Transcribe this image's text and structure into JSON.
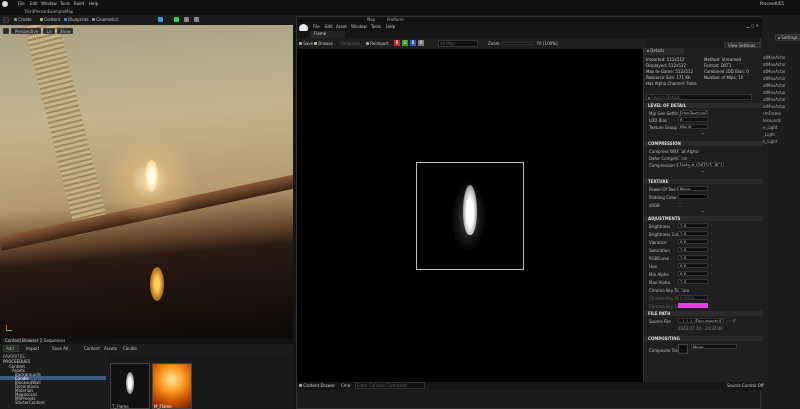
{
  "main_menu": [
    "File",
    "Edit",
    "Window",
    "Tools",
    "Build",
    "Help"
  ],
  "project_tab": "ThirdPersonExampleMap",
  "project_name": "ProceedUE5",
  "toolbar": [
    "Create",
    "Content",
    "Blueprints",
    "Cinematics"
  ],
  "settings_label": "Settings",
  "viewport": {
    "perspective": "Perspective",
    "lit": "Lit",
    "show": "Show"
  },
  "outliner": {
    "items": [
      "atMovActor",
      "atMovActor",
      "atMovActor",
      "atMovActor",
      "atMovActor",
      "atMovActor",
      "atMovActor",
      "atMovActor",
      "rmFrame",
      "lesounds",
      "e_Light",
      "_Light",
      "k_Light"
    ]
  },
  "content_browser": {
    "tabs": [
      "Content Browser 1",
      "Sequencer"
    ],
    "toolbar": [
      "Add",
      "Import",
      "Save All"
    ],
    "path": [
      "Content",
      "Assets",
      "Candle"
    ],
    "favorites_label": "FAVORITES",
    "project_label": "PROCEEDUE5",
    "tree": [
      "Content",
      "Assets",
      "Backgrounds",
      "Candle",
      "BlockoutWall",
      "Decorations",
      "Materials",
      "Megascans",
      "MSPresets",
      "StarterContent"
    ],
    "assets": [
      {
        "name": "T_Flame"
      },
      {
        "name": "M_Flame"
      }
    ]
  },
  "editor": {
    "tabs": [
      "Map",
      "Platform"
    ],
    "asset_tab": "Flame",
    "menu": [
      "File",
      "Edit",
      "Asset",
      "Window",
      "Tools",
      "Help"
    ],
    "toolbar": {
      "save": "Save",
      "browse": "Browse",
      "compress": "Compress",
      "reimport": "Reimport",
      "channels": [
        "R",
        "G",
        "B",
        "A"
      ],
      "mip_label": "All Mips",
      "zoom_label": "Zoom",
      "zoom_value": "Fit [100%]",
      "view_settings": "View Settings"
    },
    "bottom": {
      "content_drawer": "Content Drawer",
      "cmd": "Cmd",
      "cmd_placeholder": "Enter Console Command",
      "source_control": "Source Control Off"
    },
    "channel_colors": [
      "#c03030",
      "#2fa02f",
      "#2f5fc0",
      "#7a7a7a"
    ]
  },
  "details": {
    "tab": "Details",
    "info": {
      "left": [
        "Imported: 512x512",
        "Displayed: 512x512",
        "Max In-Game: 512x512",
        "Resource Size: 171 Kb",
        "Has Alpha Channel: False"
      ],
      "right": [
        "Method: Streamed",
        "Format: DXT1",
        "Combined LOD Bias: 0",
        "Number of Mips: 10"
      ]
    },
    "search_placeholder": "Search Details",
    "sections": {
      "lod": {
        "title": "LEVEL OF DETAIL",
        "rows": [
          {
            "label": "Mip Gen Settings",
            "value": "FromTextureGroup"
          },
          {
            "label": "LOD Bias",
            "value": "0"
          },
          {
            "label": "Texture Group",
            "value": "World"
          }
        ]
      },
      "compression": {
        "title": "COMPRESSION",
        "rows": [
          {
            "label": "Compress Without Alpha",
            "value": ""
          },
          {
            "label": "Defer Compression",
            "value": ""
          },
          {
            "label": "Compression Settings",
            "value": "Default (DXT1/5, BC1/3 on DX11)"
          }
        ]
      },
      "texture": {
        "title": "TEXTURE",
        "rows": [
          {
            "label": "Power Of Two Mode",
            "value": "None"
          },
          {
            "label": "Padding Color",
            "value": ""
          },
          {
            "label": "sRGB",
            "value": ""
          }
        ]
      },
      "adjustments": {
        "title": "ADJUSTMENTS",
        "rows": [
          {
            "label": "Brightness",
            "value": "1.0"
          },
          {
            "label": "Brightness Curve",
            "value": "1.0"
          },
          {
            "label": "Vibrance",
            "value": "0.0"
          },
          {
            "label": "Saturation",
            "value": "1.0"
          },
          {
            "label": "RGBCurve",
            "value": "1.0"
          },
          {
            "label": "Hue",
            "value": "0.0"
          },
          {
            "label": "Min Alpha",
            "value": "0.0"
          },
          {
            "label": "Max Alpha",
            "value": "1.0"
          },
          {
            "label": "Chroma Key Texture",
            "value": ""
          },
          {
            "label": "Chroma Key Threshold",
            "value": "0.0039"
          },
          {
            "label": "Chroma Key Color",
            "value": ""
          }
        ]
      },
      "file_path": {
        "title": "FILE PATH",
        "rows": [
          {
            "label": "Source File",
            "value": "../../../../Documents/Candle/Flame.png"
          }
        ],
        "timestamp": "2023.07.30 - 14:37:40"
      },
      "compositing": {
        "title": "COMPOSITING",
        "rows": [
          {
            "label": "Composite Texture",
            "value": "None"
          }
        ]
      }
    },
    "chroma_color": "#e040e0"
  }
}
